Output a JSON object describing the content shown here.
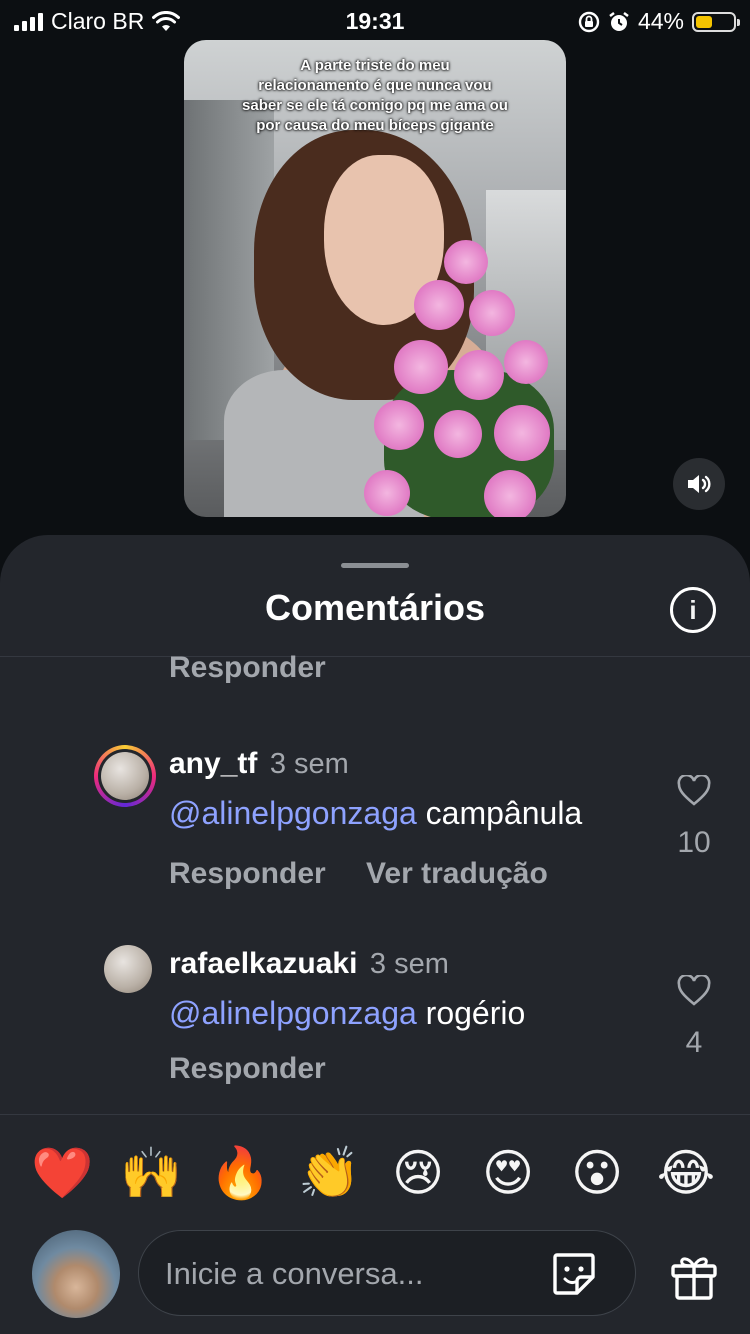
{
  "status_bar": {
    "carrier": "Claro BR",
    "time": "19:31",
    "battery_percent": "44%",
    "battery_level": 0.44
  },
  "video": {
    "caption_lines": [
      "A parte triste do meu",
      "relacionamento é que nunca vou",
      "saber se ele tá comigo pq me ama ou",
      "por causa do meu bíceps gigante"
    ]
  },
  "sheet": {
    "title": "Comentários",
    "top_reply_label": "Responder",
    "comments": [
      {
        "username": "any_tf",
        "time": "3 sem",
        "mention": "@alinelpgonzaga",
        "text": "campânula",
        "reply_label": "Responder",
        "translate_label": "Ver tradução",
        "likes": "10"
      },
      {
        "username": "rafaelkazuaki",
        "time": "3 sem",
        "mention": "@alinelpgonzaga",
        "text": "rogério",
        "reply_label": "Responder",
        "likes": "4"
      }
    ]
  },
  "emoji_bar": [
    "❤️",
    "🙌",
    "🔥",
    "👏",
    "😢",
    "😍",
    "😮",
    "😂"
  ],
  "composer": {
    "placeholder": "Inicie a conversa..."
  },
  "colors": {
    "sheet_bg": "#23262c",
    "mention": "#8ea2ff",
    "muted": "#a3a7ad"
  }
}
